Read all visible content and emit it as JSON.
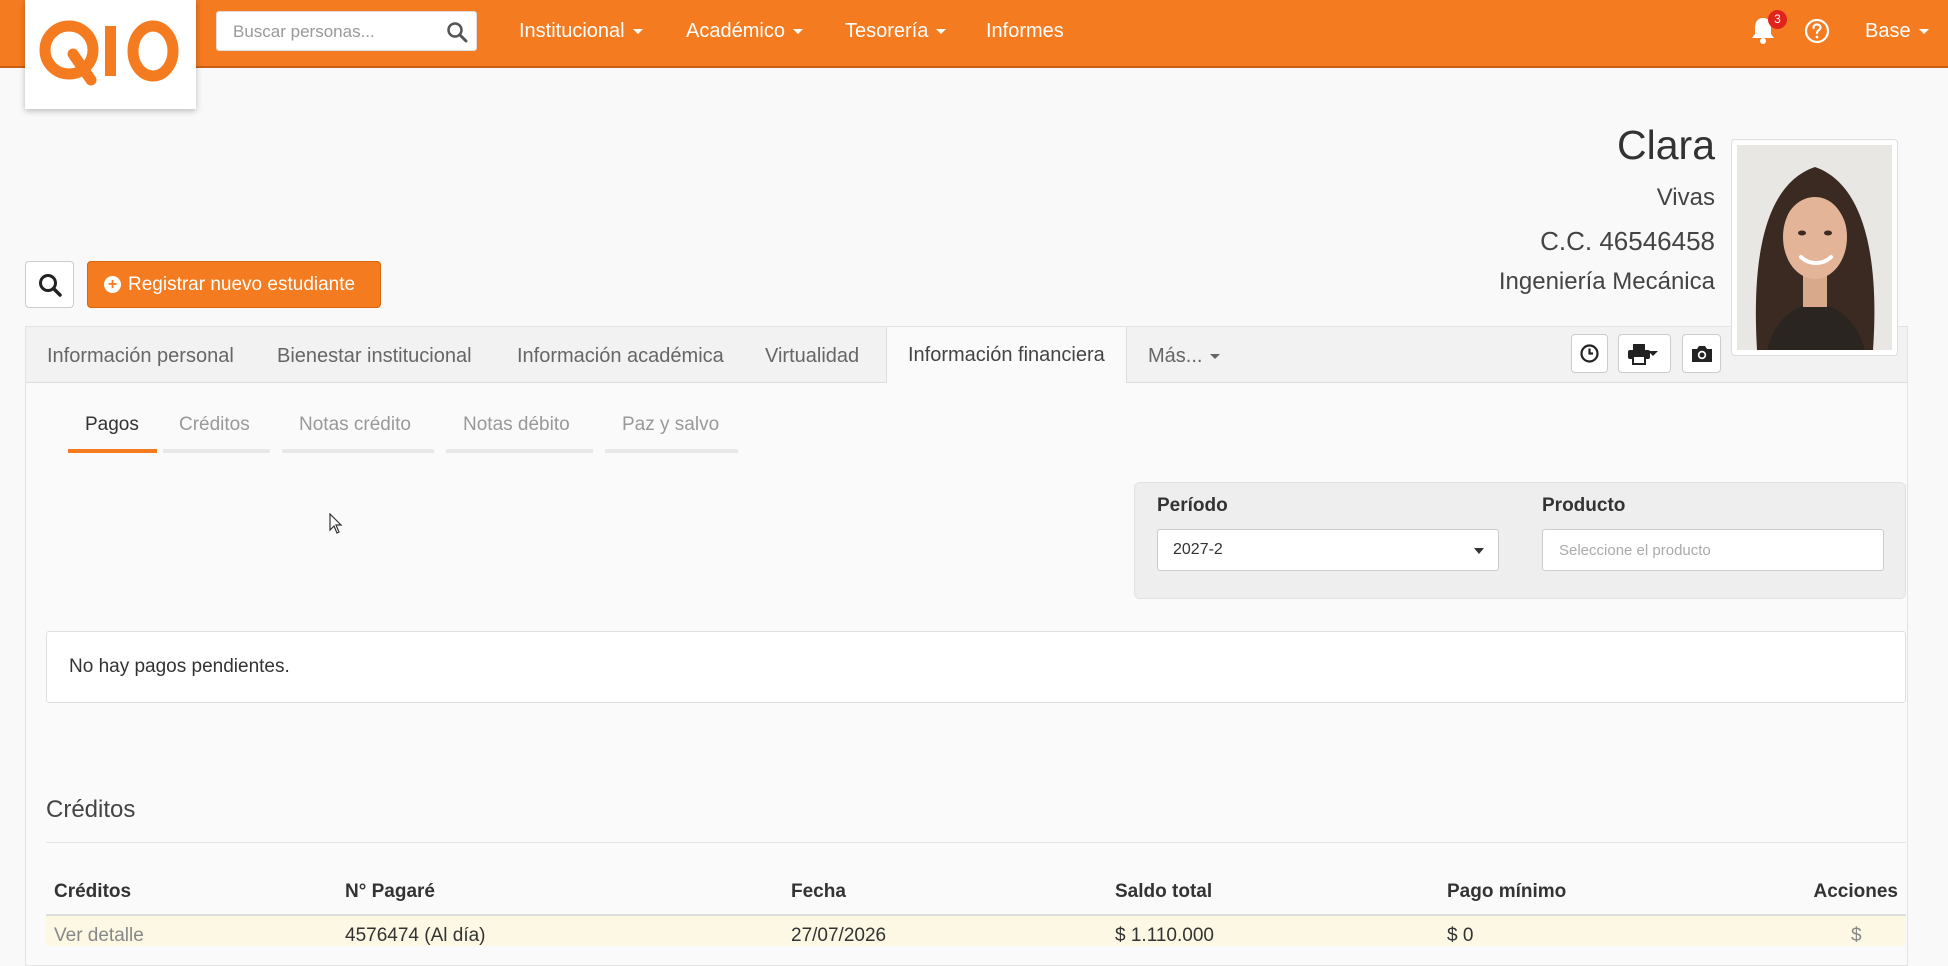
{
  "header": {
    "logo_text": "Q10",
    "search_placeholder": "Buscar personas...",
    "nav": [
      "Institucional",
      "Académico",
      "Tesorería",
      "Informes"
    ],
    "notifications_count": "3",
    "user_menu": "Base"
  },
  "colors": {
    "brand": "#f47b20",
    "badge": "#e0231b"
  },
  "profile": {
    "name": "Clara",
    "last_name": "Vivas",
    "id_doc": "C.C. 46546458",
    "program": "Ingeniería Mecánica"
  },
  "actions": {
    "register_label": "Registrar nuevo estudiante"
  },
  "tabs": [
    "Información personal",
    "Bienestar institucional",
    "Información académica",
    "Virtualidad",
    "Información financiera",
    "Más..."
  ],
  "subtabs": [
    "Pagos",
    "Créditos",
    "Notas crédito",
    "Notas débito",
    "Paz y salvo"
  ],
  "filters": {
    "period_label": "Período",
    "period_value": "2027-2",
    "product_label": "Producto",
    "product_placeholder": "Seleccione el producto"
  },
  "payments": {
    "empty_message": "No hay pagos pendientes."
  },
  "credits": {
    "title": "Créditos",
    "columns": [
      "Créditos",
      "N° Pagaré",
      "Fecha",
      "Saldo total",
      "Pago mínimo",
      "Acciones"
    ],
    "rows": [
      [
        "Ver detalle",
        "4576474 (Al día)",
        "27/07/2026",
        "$ 1.110.000",
        "$ 0",
        "$"
      ]
    ]
  }
}
